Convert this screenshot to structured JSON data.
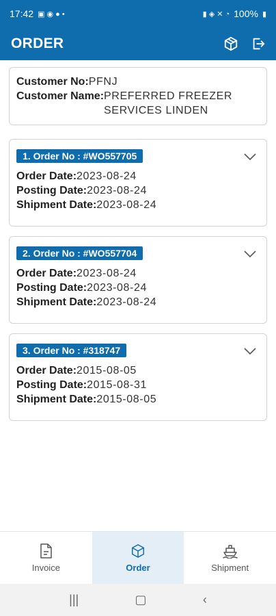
{
  "status_bar": {
    "time": "17:42",
    "battery": "100%"
  },
  "app_bar": {
    "title": "ORDER",
    "icons": [
      "box-icon",
      "logout-icon"
    ]
  },
  "customer": {
    "no_label": "Customer No:",
    "no_value": "PFNJ",
    "name_label": "Customer Name:",
    "name_line1": "PREFERRED FREEZER",
    "name_line2": "SERVICES LINDEN"
  },
  "labels": {
    "order_date": "Order Date:",
    "posting_date": "Posting Date:",
    "shipment_date": "Shipment Date:"
  },
  "orders": [
    {
      "badge": "1. Order No : #WO557705",
      "order_date": "2023-08-24",
      "posting_date": "2023-08-24",
      "shipment_date": "2023-08-24"
    },
    {
      "badge": "2. Order No : #WO557704",
      "order_date": "2023-08-24",
      "posting_date": "2023-08-24",
      "shipment_date": "2023-08-24"
    },
    {
      "badge": "3. Order No : #318747",
      "order_date": "2015-08-05",
      "posting_date": "2015-08-31",
      "shipment_date": "2015-08-05"
    }
  ],
  "bottom_nav": [
    {
      "label": "Invoice",
      "icon": "invoice-icon",
      "active": false
    },
    {
      "label": "Order",
      "icon": "box-icon",
      "active": true
    },
    {
      "label": "Shipment",
      "icon": "ship-icon",
      "active": false
    }
  ],
  "colors": {
    "primary": "#0f6cad",
    "active_tab_bg": "#e3eef7"
  }
}
